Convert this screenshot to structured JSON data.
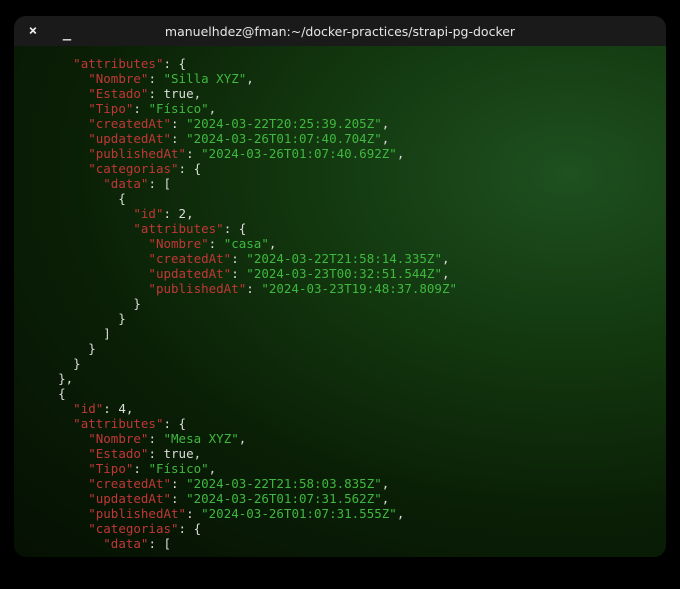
{
  "titlebar": {
    "close": "×",
    "minimize": "_",
    "title": "manuelhdez@fman:~/docker-practices/strapi-pg-docker"
  },
  "json_output": {
    "top_key": "attributes",
    "item1": {
      "Nombre": "Silla XYZ",
      "Estado": "true",
      "Tipo": "Físico",
      "createdAt": "2024-03-22T20:25:39.205Z",
      "updatedAt": "2024-03-26T01:07:40.704Z",
      "publishedAt": "2024-03-26T01:07:40.692Z",
      "categorias_key": "categorias",
      "data_key": "data",
      "categoria": {
        "id_key": "id",
        "id": "2",
        "attributes_key": "attributes",
        "Nombre": "casa",
        "createdAt": "2024-03-22T21:58:14.335Z",
        "updatedAt": "2024-03-23T00:32:51.544Z",
        "publishedAt": "2024-03-23T19:48:37.809Z"
      }
    },
    "item2": {
      "id_key": "id",
      "id": "4",
      "attributes_key": "attributes",
      "Nombre": "Mesa XYZ",
      "Estado": "true",
      "Tipo": "Físico",
      "createdAt": "2024-03-22T21:58:03.835Z",
      "updatedAt": "2024-03-26T01:07:31.562Z",
      "publishedAt": "2024-03-26T01:07:31.555Z",
      "categorias_key": "categorias",
      "data_key": "data"
    }
  }
}
